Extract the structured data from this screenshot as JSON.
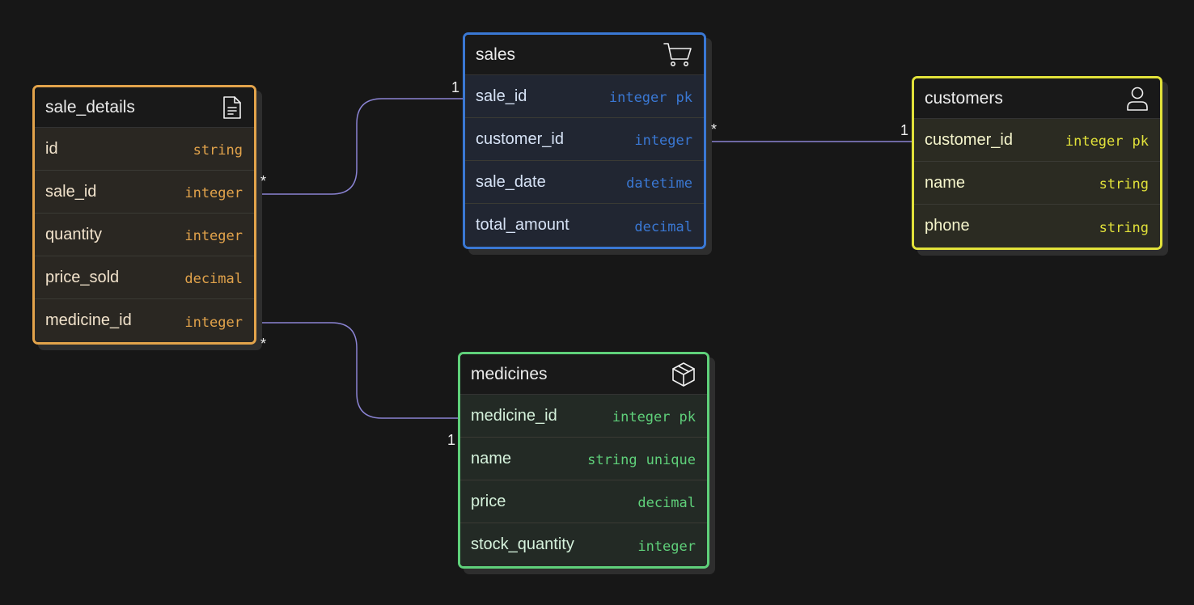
{
  "colors": {
    "canvas": "#171717",
    "edge": "#8b84d4",
    "sale_details": "#e2a34b",
    "sales": "#3a78d4",
    "customers": "#e2e23a",
    "medicines": "#5fd07a"
  },
  "entities": {
    "sale_details": {
      "name": "sale_details",
      "icon": "document-icon",
      "fields": [
        {
          "name": "id",
          "type": "string",
          "keys": ""
        },
        {
          "name": "sale_id",
          "type": "integer",
          "keys": ""
        },
        {
          "name": "quantity",
          "type": "integer",
          "keys": ""
        },
        {
          "name": "price_sold",
          "type": "decimal",
          "keys": ""
        },
        {
          "name": "medicine_id",
          "type": "integer",
          "keys": ""
        }
      ]
    },
    "sales": {
      "name": "sales",
      "icon": "shopping-cart-icon",
      "fields": [
        {
          "name": "sale_id",
          "type": "integer",
          "keys": "pk"
        },
        {
          "name": "customer_id",
          "type": "integer",
          "keys": ""
        },
        {
          "name": "sale_date",
          "type": "datetime",
          "keys": ""
        },
        {
          "name": "total_amount",
          "type": "decimal",
          "keys": ""
        }
      ]
    },
    "customers": {
      "name": "customers",
      "icon": "user-icon",
      "fields": [
        {
          "name": "customer_id",
          "type": "integer",
          "keys": "pk"
        },
        {
          "name": "name",
          "type": "string",
          "keys": ""
        },
        {
          "name": "phone",
          "type": "string",
          "keys": ""
        }
      ]
    },
    "medicines": {
      "name": "medicines",
      "icon": "package-icon",
      "fields": [
        {
          "name": "medicine_id",
          "type": "integer",
          "keys": "pk"
        },
        {
          "name": "name",
          "type": "string",
          "keys": "unique"
        },
        {
          "name": "price",
          "type": "decimal",
          "keys": ""
        },
        {
          "name": "stock_quantity",
          "type": "integer",
          "keys": ""
        }
      ]
    }
  },
  "relationships": [
    {
      "from": "sale_details.sale_id",
      "to": "sales.sale_id",
      "from_card": "*",
      "to_card": "1"
    },
    {
      "from": "sales.customer_id",
      "to": "customers.customer_id",
      "from_card": "*",
      "to_card": "1"
    },
    {
      "from": "sale_details.medicine_id",
      "to": "medicines.medicine_id",
      "from_card": "*",
      "to_card": "1"
    }
  ]
}
